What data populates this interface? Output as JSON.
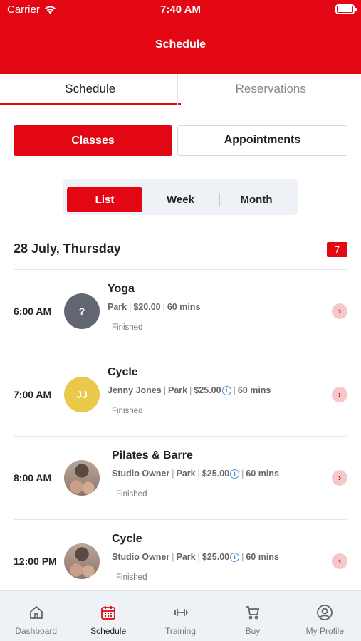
{
  "status_bar": {
    "carrier": "Carrier",
    "time": "7:40 AM"
  },
  "header": {
    "title": "Schedule"
  },
  "tabs": [
    {
      "label": "Schedule",
      "active": true
    },
    {
      "label": "Reservations",
      "active": false
    }
  ],
  "segment": {
    "classes": "Classes",
    "appointments": "Appointments"
  },
  "view_toggle": {
    "list": "List",
    "week": "Week",
    "month": "Month"
  },
  "day": {
    "title": "28 July, Thursday",
    "count": "7"
  },
  "classes": [
    {
      "time": "6:00 AM",
      "name": "Yoga",
      "avatar_text": "?",
      "details": [
        "Park",
        "$20.00",
        "60 mins"
      ],
      "status": "Finished"
    },
    {
      "time": "7:00 AM",
      "name": "Cycle",
      "avatar_text": "JJ",
      "details": [
        "Jenny Jones",
        "Park",
        "$25.00",
        "60 mins"
      ],
      "status": "Finished"
    },
    {
      "time": "8:00 AM",
      "name": "Pilates & Barre",
      "details": [
        "Studio Owner",
        "Park",
        "$25.00",
        "60 mins"
      ],
      "status": "Finished"
    },
    {
      "time": "12:00 PM",
      "name": "Cycle",
      "details": [
        "Studio Owner",
        "Park",
        "$25.00",
        "60 mins"
      ],
      "status": "Finished"
    }
  ],
  "bottom_nav": [
    {
      "label": "Dashboard",
      "icon": "home-icon"
    },
    {
      "label": "Schedule",
      "icon": "calendar-icon",
      "active": true
    },
    {
      "label": "Training",
      "icon": "dumbbell-icon"
    },
    {
      "label": "Buy",
      "icon": "cart-icon"
    },
    {
      "label": "My Profile",
      "icon": "profile-icon"
    }
  ],
  "colors": {
    "brand": "#e30613",
    "info": "#4a90d9"
  }
}
